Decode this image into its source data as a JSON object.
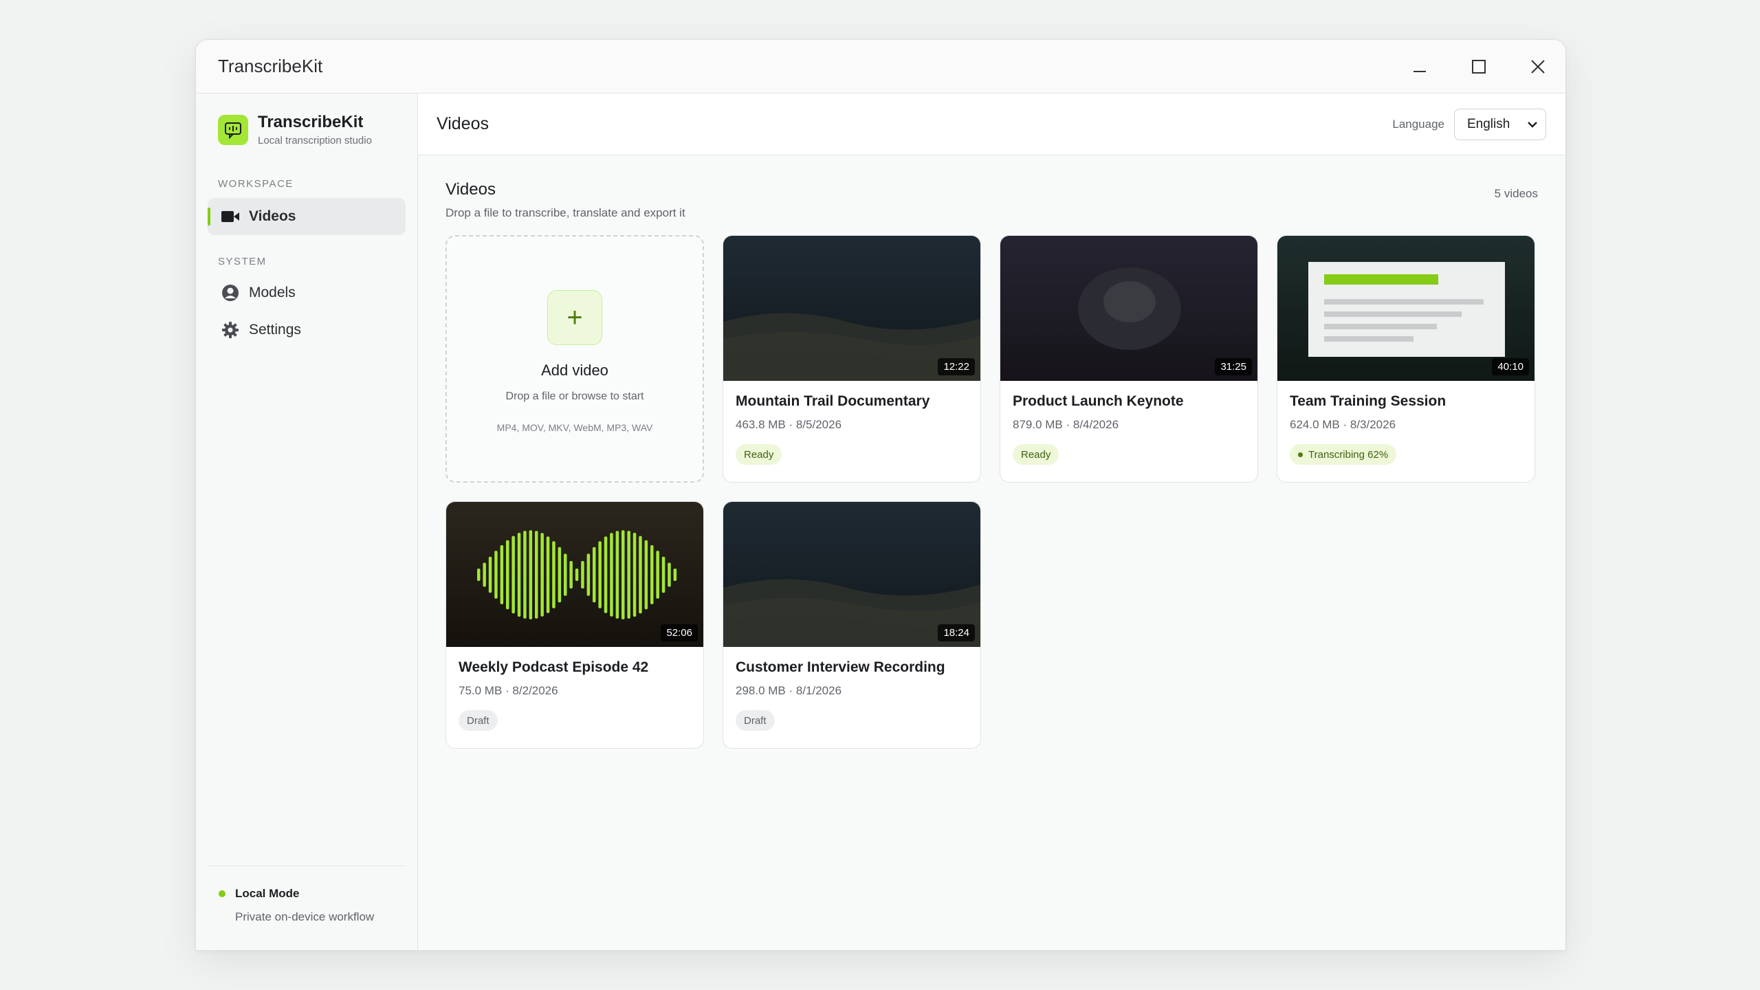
{
  "window": {
    "title": "TranscribeKit"
  },
  "sidebar": {
    "brand_name": "TranscribeKit",
    "brand_sub": "Local transcription studio",
    "workspace_label": "WORKSPACE",
    "system_label": "SYSTEM",
    "items": [
      {
        "label": "Videos",
        "icon": "video-camera-icon",
        "active": true
      },
      {
        "label": "Models",
        "icon": "user-circle-icon"
      },
      {
        "label": "Settings",
        "icon": "gear-icon"
      }
    ],
    "footer_title": "Local Mode",
    "footer_sub": "Private on-device workflow"
  },
  "header": {
    "title": "Videos",
    "language_label": "Language",
    "language_value": "English"
  },
  "content": {
    "title": "Videos",
    "subtitle": "Drop a file to transcribe, translate and export it",
    "count": "5 videos",
    "add_card": {
      "title": "Add video",
      "subtitle": "Drop a file or browse to start",
      "formats": "MP4, MOV, MKV, WebM, MP3, WAV"
    },
    "videos": [
      {
        "title": "Mountain Trail Documentary",
        "meta": "463.8 MB · 8/5/2026",
        "duration": "12:22",
        "status": "Ready",
        "thumbnail": "mountain-landscape"
      },
      {
        "title": "Product Launch Keynote",
        "meta": "879.0 MB · 8/4/2026",
        "duration": "31:25",
        "status": "Ready",
        "thumbnail": "spotlight"
      },
      {
        "title": "Team Training Session",
        "meta": "624.0 MB · 8/3/2026",
        "duration": "40:10",
        "status": "Transcribing 62%",
        "thumbnail": "slide-document"
      },
      {
        "title": "Weekly Podcast Episode 42",
        "meta": "75.0 MB · 8/2/2026",
        "duration": "52:06",
        "status": "Draft",
        "thumbnail": "audio-waveform"
      },
      {
        "title": "Customer Interview Recording",
        "meta": "298.0 MB · 8/1/2026",
        "duration": "18:24",
        "status": "Draft",
        "thumbnail": "mountain-landscape"
      }
    ]
  },
  "colors": {
    "accent": "#84cc16",
    "brand_bg": "#a3e635"
  }
}
